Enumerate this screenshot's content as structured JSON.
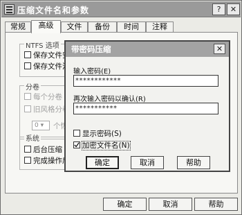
{
  "window": {
    "title": "压缩文件名和参数",
    "help_button": "?",
    "close_button": "✕"
  },
  "tabs": [
    {
      "label": "常规",
      "active": false
    },
    {
      "label": "高级",
      "active": true
    },
    {
      "label": "文件",
      "active": false
    },
    {
      "label": "备份",
      "active": false
    },
    {
      "label": "时间",
      "active": false
    },
    {
      "label": "注释",
      "active": false
    }
  ],
  "ntfs_group": {
    "label": "NTFS 选项",
    "items": [
      "保存文件安",
      "保存文件流"
    ]
  },
  "volume_group": {
    "label": "分卷",
    "items": [
      "每个分卷 ",
      "旧风格分卷"
    ],
    "spin_value": "0",
    "spin_suffix": "个恢"
  },
  "system_group": {
    "label": "系统",
    "items": [
      "后台压缩",
      "完成操作后"
    ]
  },
  "right_heading": "...",
  "buttons": {
    "ok": "确定",
    "cancel": "取消",
    "help": "帮助"
  },
  "dialog": {
    "title": "带密码压缩",
    "close": "✕",
    "password_label": "输入密码(E)",
    "password_value": "************",
    "confirm_label": "再次输入密码以确认(R)",
    "confirm_value": "***********",
    "show_password": {
      "label": "显示密码(S)",
      "checked": false
    },
    "encrypt_names": {
      "label": "加密文件名(N)",
      "checked": true
    },
    "buttons": {
      "ok": "确定",
      "cancel": "取消",
      "help": "帮助"
    }
  }
}
